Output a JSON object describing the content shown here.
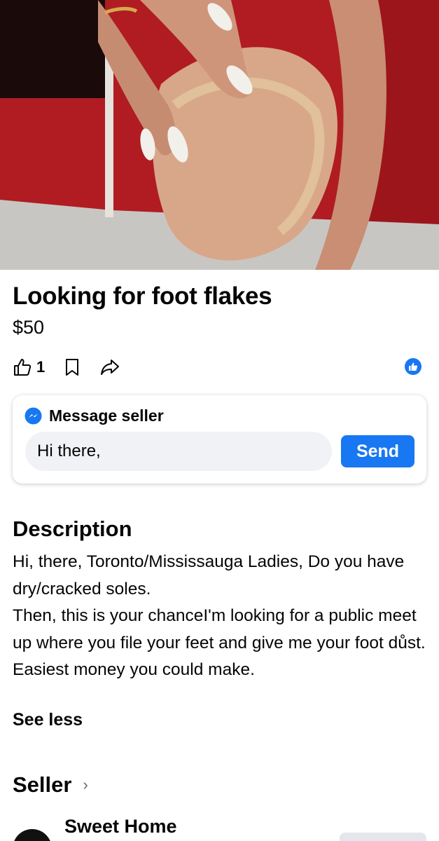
{
  "listing": {
    "title": "Looking for foot flakes",
    "price": "$50"
  },
  "actions": {
    "like_count": "1",
    "icons": [
      "thumbs-up-icon",
      "bookmark-icon",
      "share-icon"
    ],
    "reaction_icon": "like-reaction-icon"
  },
  "message": {
    "heading": "Message seller",
    "input_value": "Hi there,",
    "send_label": "Send"
  },
  "description": {
    "heading": "Description",
    "lines": [
      "Hi, there, Toronto/Mississauga Ladies, Do you have dry/cracked soles.",
      "Then, this is your chanceI'm looking for a public meet up where you file your feet and give me your foot důst.",
      "Easiest money you could make."
    ],
    "see_less": "See less"
  },
  "seller": {
    "heading": "Seller",
    "chevron": "›",
    "name": "Sweet Home"
  },
  "colors": {
    "accent": "#1877f2",
    "input_bg": "#f0f2f5",
    "text": "#050505"
  }
}
